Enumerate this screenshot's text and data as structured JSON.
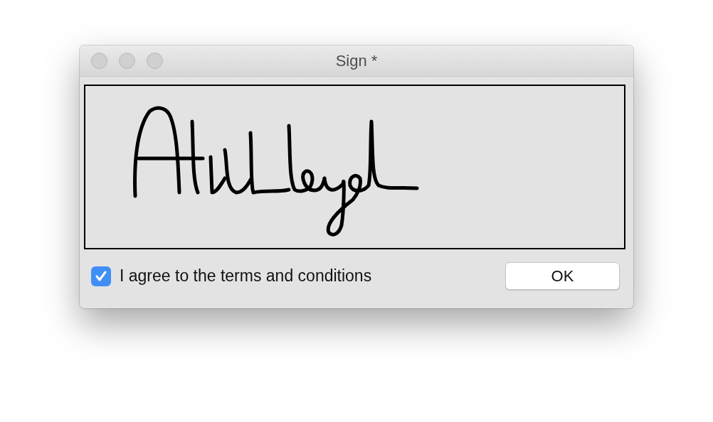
{
  "window": {
    "title": "Sign *"
  },
  "agreement": {
    "label": "I agree to the terms and conditions",
    "checked": true
  },
  "buttons": [
    {
      "label": "OK"
    }
  ]
}
